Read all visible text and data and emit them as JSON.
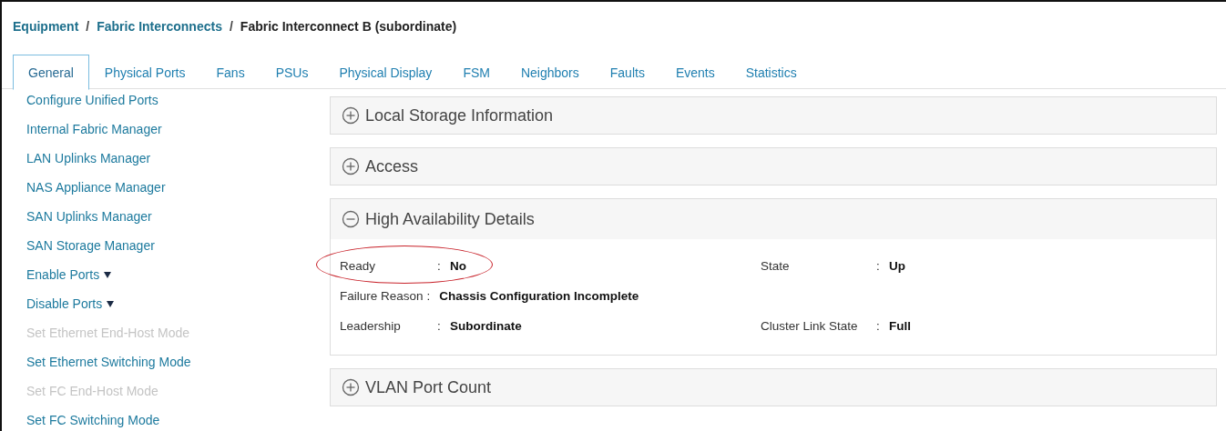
{
  "breadcrumb": [
    {
      "label": "Equipment",
      "kind": "link"
    },
    {
      "label": "Fabric Interconnects",
      "kind": "link"
    },
    {
      "label": "Fabric Interconnect B (subordinate)",
      "kind": "current"
    }
  ],
  "tabs": [
    {
      "label": "General",
      "selected": true
    },
    {
      "label": "Physical Ports",
      "selected": false
    },
    {
      "label": "Fans",
      "selected": false
    },
    {
      "label": "PSUs",
      "selected": false
    },
    {
      "label": "Physical Display",
      "selected": false
    },
    {
      "label": "FSM",
      "selected": false
    },
    {
      "label": "Neighbors",
      "selected": false
    },
    {
      "label": "Faults",
      "selected": false
    },
    {
      "label": "Events",
      "selected": false
    },
    {
      "label": "Statistics",
      "selected": false
    }
  ],
  "actions": [
    {
      "label": "Configure Unified Ports",
      "kind": "link",
      "disabled": false
    },
    {
      "label": "Internal Fabric Manager",
      "kind": "link",
      "disabled": false
    },
    {
      "label": "LAN Uplinks Manager",
      "kind": "link",
      "disabled": false
    },
    {
      "label": "NAS Appliance Manager",
      "kind": "link",
      "disabled": false
    },
    {
      "label": "SAN Uplinks Manager",
      "kind": "link",
      "disabled": false
    },
    {
      "label": "SAN Storage Manager",
      "kind": "link",
      "disabled": false
    },
    {
      "label": "Enable Ports",
      "kind": "dropdown",
      "disabled": false
    },
    {
      "label": "Disable Ports",
      "kind": "dropdown",
      "disabled": false
    },
    {
      "label": "Set Ethernet End-Host Mode",
      "kind": "link",
      "disabled": true
    },
    {
      "label": "Set Ethernet Switching Mode",
      "kind": "link",
      "disabled": false
    },
    {
      "label": "Set FC End-Host Mode",
      "kind": "link",
      "disabled": true
    },
    {
      "label": "Set FC Switching Mode",
      "kind": "link",
      "disabled": false
    }
  ],
  "panels": [
    {
      "title": "Local Storage Information",
      "expanded": false
    },
    {
      "title": "Access",
      "expanded": false
    },
    {
      "title": "High Availability Details",
      "expanded": true,
      "fields": [
        [
          {
            "label": "Ready",
            "value": "No",
            "highlighted": true
          },
          {
            "label": "State",
            "value": "Up",
            "highlighted": false
          }
        ],
        [
          {
            "label": "Failure Reason",
            "value": "Chassis Configuration Incomplete",
            "highlighted": false
          }
        ],
        [
          {
            "label": "Leadership",
            "value": "Subordinate",
            "highlighted": false
          },
          {
            "label": "Cluster Link State",
            "value": "Full",
            "highlighted": false
          }
        ]
      ]
    },
    {
      "title": "VLAN Port Count",
      "expanded": false
    }
  ],
  "separator": ":",
  "breadcrumb_separator": "/"
}
